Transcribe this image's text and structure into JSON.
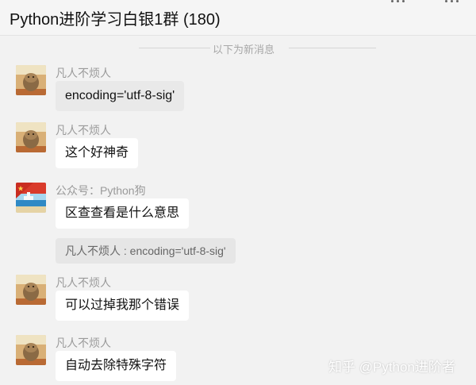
{
  "window": {
    "title": "Python进阶学习白银1群 (180)"
  },
  "divider": {
    "text": "以下为新消息"
  },
  "messages": [
    {
      "sender": "凡人不烦人",
      "text": "encoding='utf-8-sig'",
      "avatar": "cat-avatar",
      "style": "gray"
    },
    {
      "sender": "凡人不烦人",
      "text": "这个好神奇",
      "avatar": "cat-avatar",
      "style": "white"
    },
    {
      "sender": "公众号：Python狗",
      "text": "区查查看是什么意思",
      "avatar": "flag-harbor-avatar",
      "style": "white"
    },
    {
      "sender": "凡人不烦人",
      "text": "可以过掉我那个错误",
      "avatar": "cat-avatar",
      "style": "white"
    },
    {
      "sender": "凡人不烦人",
      "text": "自动去除特殊字符",
      "avatar": "cat-avatar",
      "style": "white"
    }
  ],
  "quote": {
    "text": "凡人不烦人 : encoding='utf-8-sig'"
  },
  "watermark": {
    "text": "知乎 @Python进阶者"
  }
}
